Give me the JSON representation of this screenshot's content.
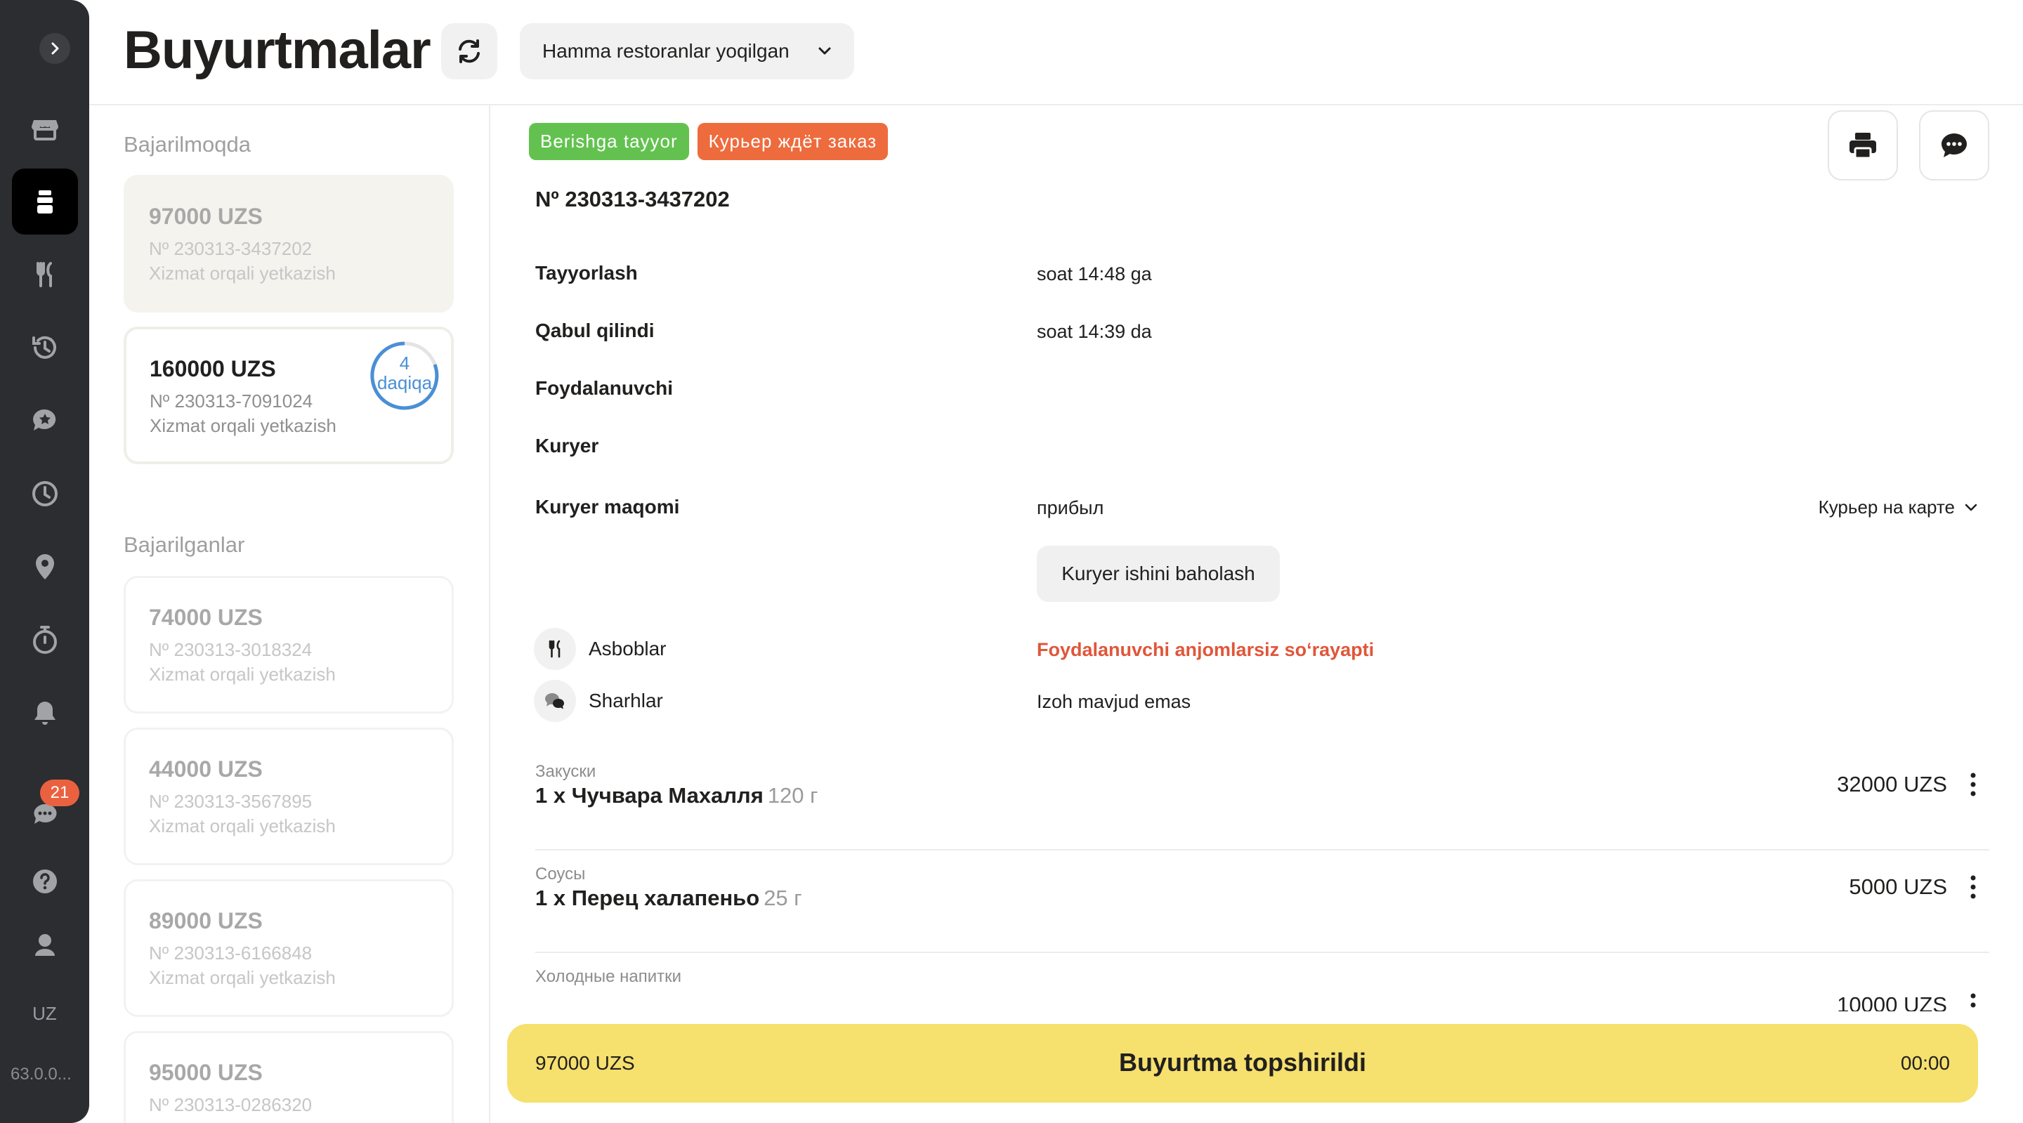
{
  "sidebar": {
    "items": [
      {
        "name": "store",
        "icon": "store-icon"
      },
      {
        "name": "orders",
        "icon": "orders-icon",
        "active": true
      },
      {
        "name": "menu",
        "icon": "fork-knife-icon"
      },
      {
        "name": "history",
        "icon": "history-icon"
      },
      {
        "name": "reviews",
        "icon": "reviews-icon"
      },
      {
        "name": "schedule",
        "icon": "clock-icon"
      },
      {
        "name": "location",
        "icon": "pin-icon"
      },
      {
        "name": "timer",
        "icon": "stopwatch-icon"
      },
      {
        "name": "notifications",
        "icon": "bell-icon"
      },
      {
        "name": "chats",
        "icon": "chat-icon"
      },
      {
        "name": "help",
        "icon": "help-icon"
      },
      {
        "name": "support",
        "icon": "agent-icon"
      }
    ],
    "chat_badge": "21",
    "language": "UZ",
    "version": "63.0.0..."
  },
  "header": {
    "title": "Buyurtmalar",
    "restaurant_select": "Hamma restoranlar yoqilgan"
  },
  "list": {
    "in_progress_label": "Bajarilmoqda",
    "completed_label": "Bajarilganlar",
    "in_progress": [
      {
        "price": "97000 UZS",
        "number": "Nº 230313-3437202",
        "type": "Xizmat orqali yetkazish"
      },
      {
        "price": "160000 UZS",
        "number": "Nº 230313-7091024",
        "type": "Xizmat orqali yetkazish",
        "timer_value": "4",
        "timer_unit": "daqiqa"
      }
    ],
    "completed": [
      {
        "price": "74000 UZS",
        "number": "Nº 230313-3018324",
        "type": "Xizmat orqali yetkazish"
      },
      {
        "price": "44000 UZS",
        "number": "Nº 230313-3567895",
        "type": "Xizmat orqali yetkazish"
      },
      {
        "price": "89000 UZS",
        "number": "Nº 230313-6166848",
        "type": "Xizmat orqali yetkazish"
      },
      {
        "price": "95000 UZS",
        "number": "Nº 230313-0286320",
        "type": ""
      }
    ]
  },
  "detail": {
    "tags": [
      "Berishga tayyor",
      "Курьер ждёт заказ"
    ],
    "order_number": "Nº 230313-3437202",
    "rows": {
      "prepare_label": "Tayyorlash",
      "prepare_value": "soat 14:48 ga",
      "accepted_label": "Qabul qilindi",
      "accepted_value": "soat 14:39 da",
      "user_label": "Foydalanuvchi",
      "courier_label": "Kuryer",
      "courier_status_label": "Kuryer maqomi",
      "courier_status_value": "прибыл",
      "map_link": "Курьер на карте",
      "rate_button": "Kuryer ishini baholash",
      "cutlery_label": "Asboblar",
      "cutlery_value": "Foydalanuvchi anjomlarsiz so‘rayapti",
      "comments_label": "Sharhlar",
      "comments_value": "Izoh mavjud emas"
    },
    "items": [
      {
        "category": "Закуски",
        "name": "1 x Чучвара Махалля",
        "weight": "120 г",
        "price": "32000 UZS"
      },
      {
        "category": "Соусы",
        "name": "1 x Перец халапеньо",
        "weight": "25 г",
        "price": "5000 UZS"
      },
      {
        "category": "Холодные напитки",
        "name": "",
        "weight": "",
        "price": "10000 UZS"
      }
    ]
  },
  "footer": {
    "price": "97000 UZS",
    "label": "Buyurtma topshirildi",
    "time": "00:00"
  },
  "colors": {
    "sidebar_bg": "#2c2d30",
    "accent_yellow": "#f6e06e",
    "tag_green": "#63c24f",
    "tag_orange": "#ee6b3d",
    "warning_text": "#e0563a",
    "timer_blue": "#4a8fd6"
  }
}
